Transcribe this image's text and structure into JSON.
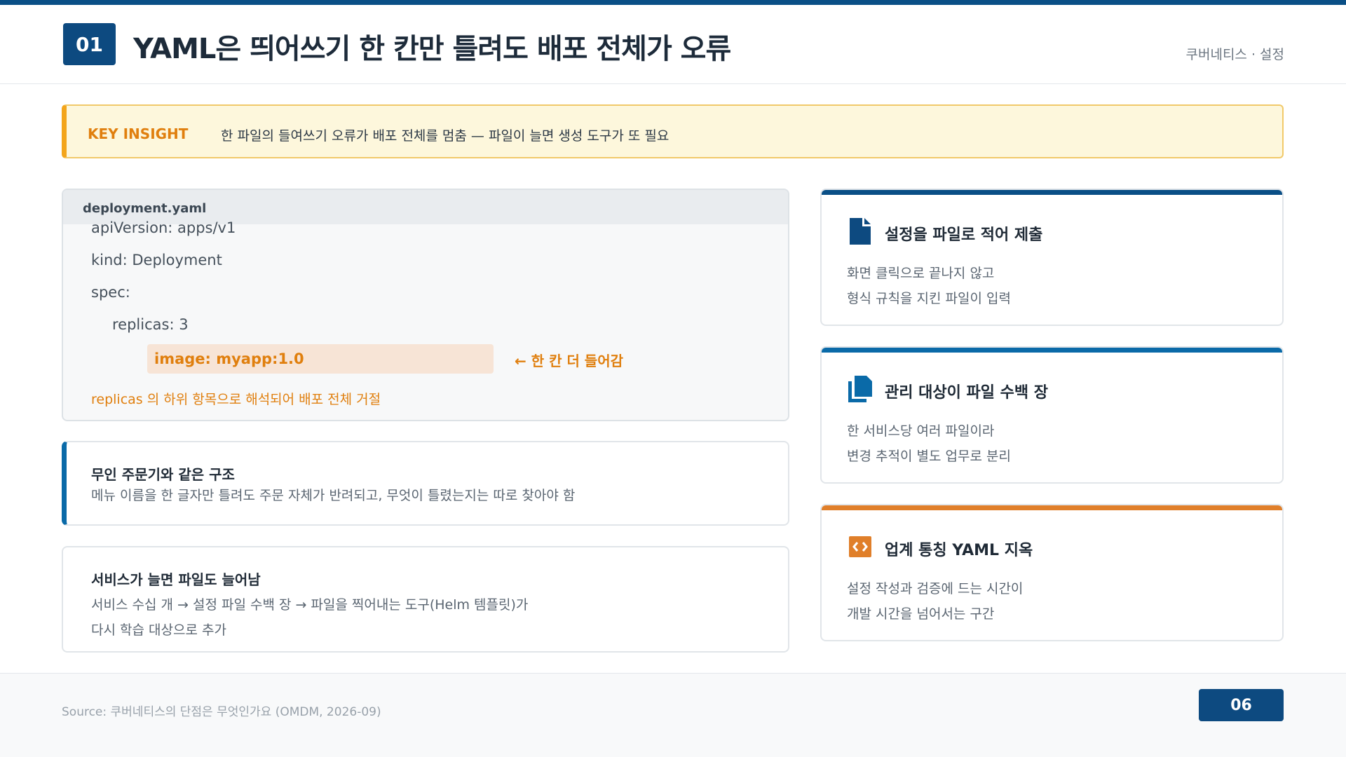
{
  "header": {
    "slide_number": "01",
    "title": "YAML은 띄어쓰기 한 칸만 틀려도 배포 전체가 오류",
    "section": "쿠버네티스 · 설정"
  },
  "insight": {
    "tag": "KEY INSIGHT",
    "text": "한 파일의 들여쓰기 오류가 배포 전체를 멈춤 — 파일이 늘면 생성 도구가 또 필요"
  },
  "code": {
    "filename": "deployment.yaml",
    "lines": [
      "apiVersion: apps/v1",
      "kind: Deployment",
      "spec:",
      "replicas: 3"
    ],
    "highlight_line": "image: myapp:1.0",
    "arrow_note": "← 한 칸 더 들어감",
    "footnote": "replicas 의 하위 항목으로 해석되어 배포 전체 거절"
  },
  "cards": [
    {
      "title": "무인 주문기와 같은 구조",
      "lines": [
        "메뉴 이름을 한 글자만 틀려도 주문 자체가 반려되고, 무엇이 틀렸는지는 따로 찾아야 함"
      ]
    },
    {
      "title": "서비스가 늘면 파일도 늘어남",
      "lines": [
        "서비스 수십 개 → 설정 파일 수백 장 → 파일을 찍어내는 도구(Helm 템플릿)가",
        "다시 학습 대상으로 추가"
      ]
    }
  ],
  "features": [
    {
      "icon": "file-icon",
      "title": "설정을 파일로 적어 제출",
      "lines": [
        "화면 클릭으로 끝나지 않고",
        "형식 규칙을 지킨 파일이 입력"
      ],
      "accent": "#0a4f86"
    },
    {
      "icon": "files-stack-icon",
      "title": "관리 대상이 파일 수백 장",
      "lines": [
        "한 서비스당 여러 파일이라",
        "변경 추적이 별도 업무로 분리"
      ],
      "accent": "#0a6aa8"
    },
    {
      "icon": "code-brackets-icon",
      "title": "업계 통칭 YAML 지옥",
      "lines": [
        "설정 작성과 검증에 드는 시간이",
        "개발 시간을 넘어서는 구간"
      ],
      "accent": "#e07f2a"
    }
  ],
  "footer": {
    "source": "Source: 쿠버네티스의 단점은 무엇인가요 (OMDM, 2026-09)",
    "page_number": "06"
  },
  "colors": {
    "primary": "#0d4a80",
    "accent_orange": "#e07f0e",
    "insight_bg": "#fdf7dc"
  }
}
